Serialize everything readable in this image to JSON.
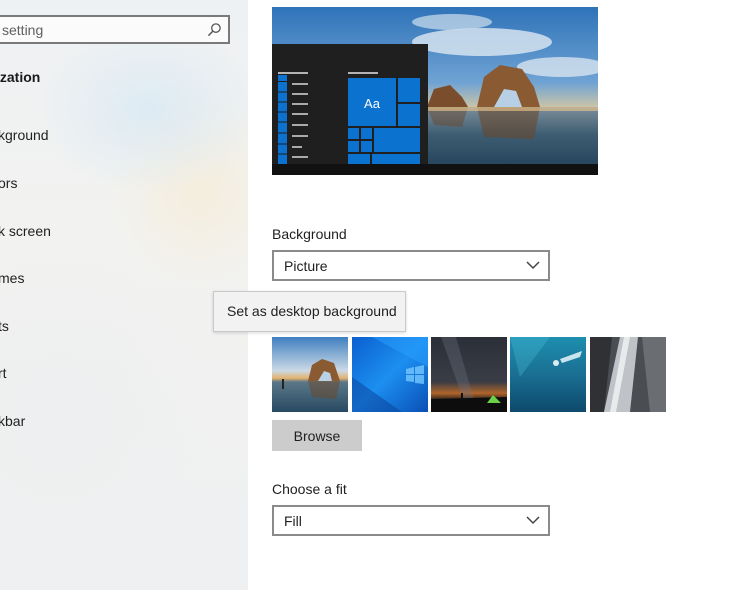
{
  "sidebar": {
    "search_placeholder": "setting",
    "section_title": "ization",
    "items": [
      {
        "label": "kground"
      },
      {
        "label": "ors"
      },
      {
        "label": "k screen"
      },
      {
        "label": "mes"
      },
      {
        "label": "ts"
      },
      {
        "label": "rt"
      },
      {
        "label": "kbar"
      }
    ]
  },
  "preview": {
    "tile_text": "Aa"
  },
  "background": {
    "label": "Background",
    "value": "Picture",
    "tooltip": "Set as desktop background"
  },
  "browse_label": "Browse",
  "fit": {
    "label": "Choose a fit",
    "value": "Fill"
  },
  "colors": {
    "accent": "#0078d7",
    "sidebar_bg": "#eef1f3",
    "button_bg": "#cccccc"
  }
}
